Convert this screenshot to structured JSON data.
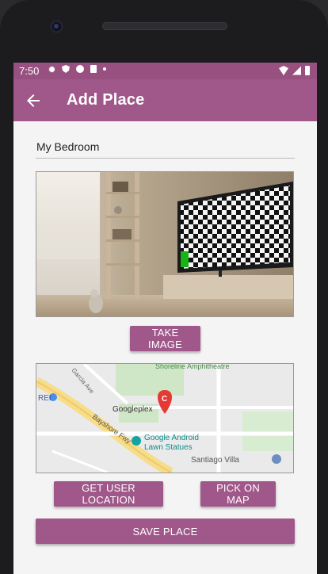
{
  "status_bar": {
    "time": "7:50",
    "icons_left": [
      "gear-icon",
      "shield-icon",
      "a-icon",
      "card-icon",
      "dot-icon"
    ],
    "icons_right": [
      "wifi-icon",
      "signal-icon",
      "battery-icon"
    ]
  },
  "app_bar": {
    "title": "Add Place",
    "back_icon": "arrow-back-icon"
  },
  "form": {
    "title_value": "My Bedroom"
  },
  "map": {
    "labels": {
      "shoreline": "Shoreline Amphitheatre",
      "rei": "REI",
      "googleplex": "Googleplex",
      "google_android": "Google Android",
      "lawn_statues": "Lawn Statues",
      "santiago": "Santiago Villa",
      "bayshore": "Bayshore Fwy",
      "garcia": "Garcia Ave",
      "pin": "C"
    }
  },
  "buttons": {
    "take_image": "TAKE IMAGE",
    "get_location": "GET USER LOCATION",
    "pick_on_map": "PICK ON MAP",
    "save_place": "SAVE PLACE"
  },
  "colors": {
    "status_bar": "#985081",
    "app_bar": "#a0578a",
    "button": "#a0578a",
    "background": "#f4f4f4"
  }
}
